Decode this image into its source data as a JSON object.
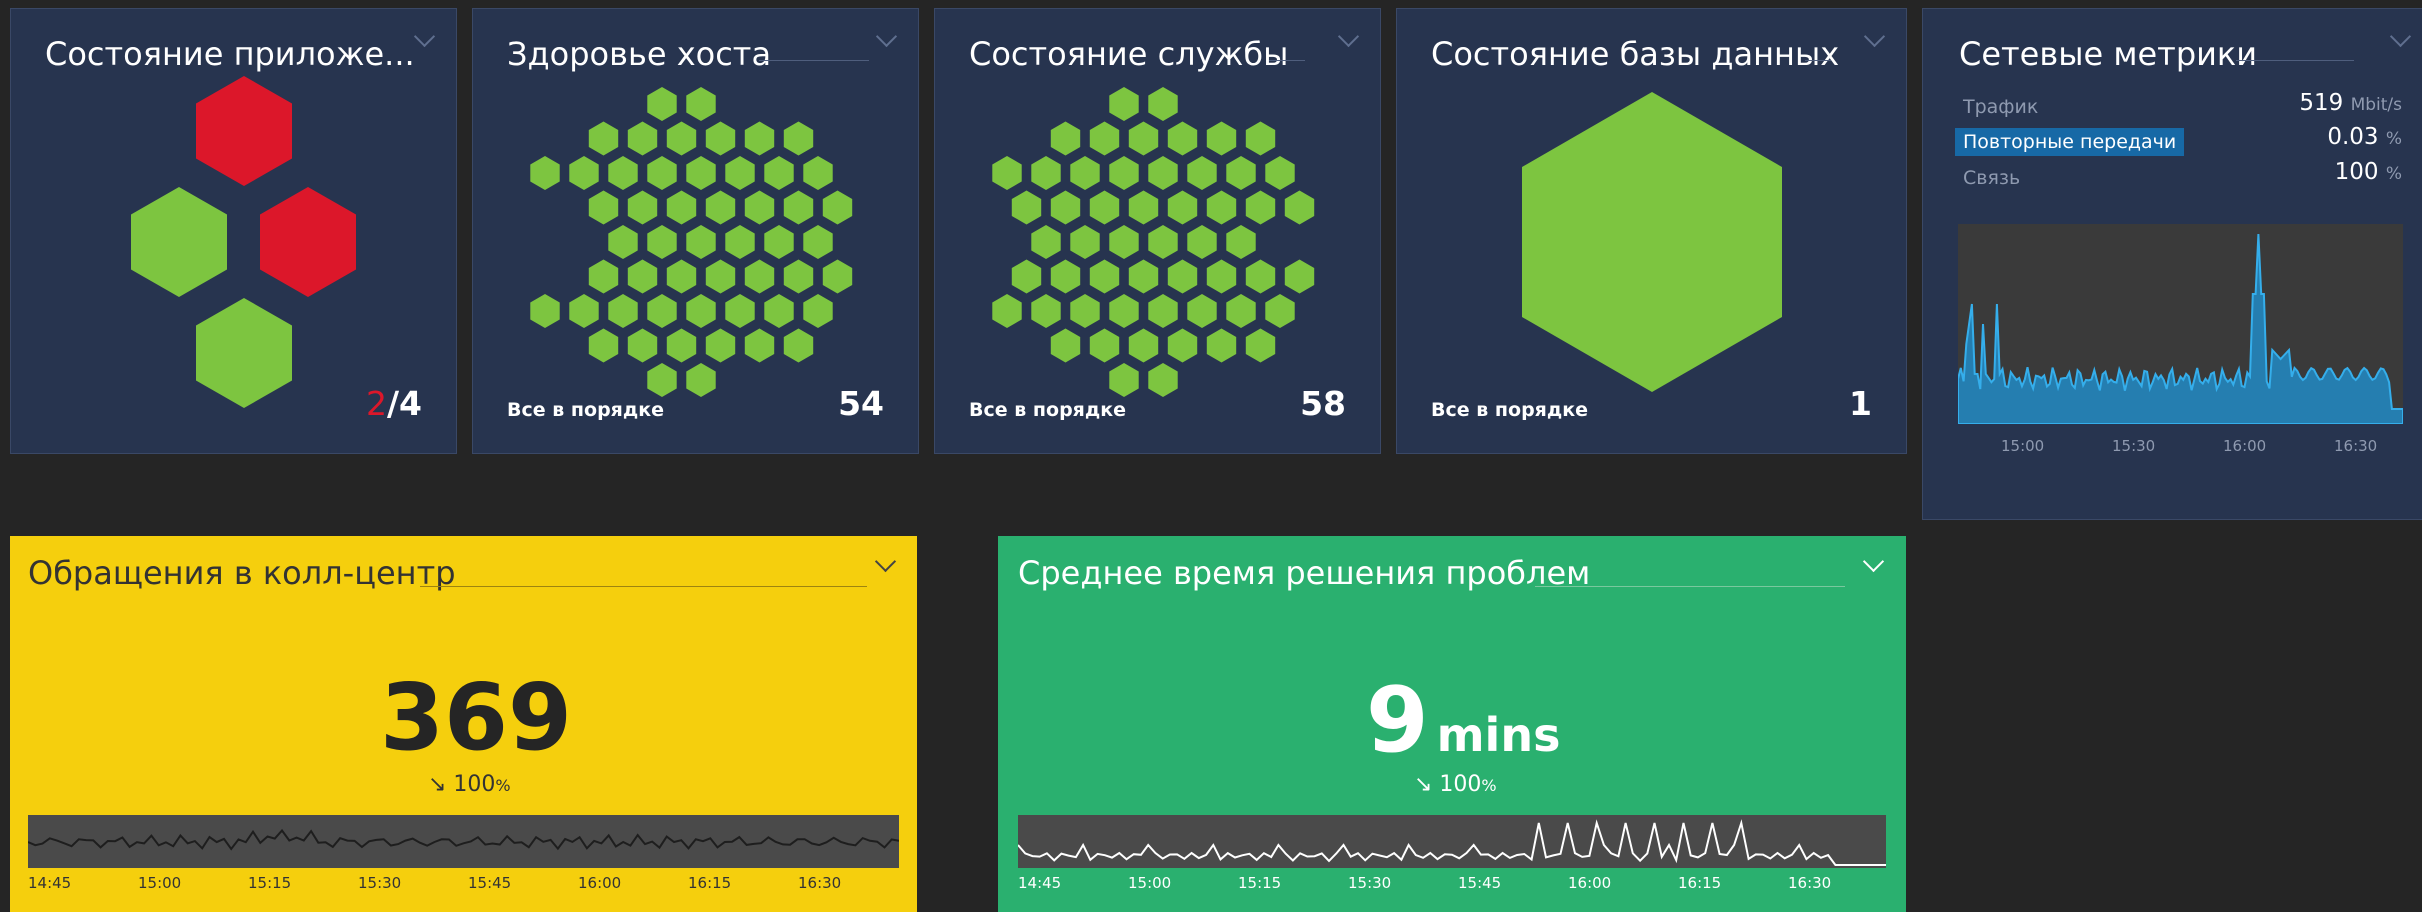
{
  "tiles": {
    "app": {
      "title": "Состояние приложе...",
      "problem_count": "2",
      "total_count": "/4"
    },
    "host": {
      "title": "Здоровье хоста",
      "status": "Все в порядке",
      "count": "54"
    },
    "service": {
      "title": "Состояние службы",
      "status": "Все в порядке",
      "count": "58"
    },
    "database": {
      "title": "Состояние базы данных",
      "status": "Все в порядке",
      "count": "1"
    }
  },
  "network": {
    "title": "Сетевые метрики",
    "metrics": [
      {
        "label": "Трафик",
        "value": "519",
        "unit": "Mbit/s"
      },
      {
        "label": "Повторные передачи",
        "value": "0.03",
        "unit": "%"
      },
      {
        "label": "Связь",
        "value": "100",
        "unit": "%"
      }
    ],
    "time_ticks": [
      "15:00",
      "15:30",
      "16:00",
      "16:30"
    ]
  },
  "calls": {
    "title": "Обращения в колл-центр",
    "value": "369",
    "change": "↘ 100",
    "change_unit": "%",
    "time_ticks": [
      "14:45",
      "15:00",
      "15:15",
      "15:30",
      "15:45",
      "16:00",
      "16:15",
      "16:30"
    ]
  },
  "resolution": {
    "title": "Среднее время решения проблем",
    "value": "9",
    "unit": "mins",
    "change": "↘ 100",
    "change_unit": "%",
    "time_ticks": [
      "14:45",
      "15:00",
      "15:15",
      "15:30",
      "15:45",
      "16:00",
      "16:15",
      "16:30"
    ]
  },
  "colors": {
    "ok": "#7dc540",
    "problem": "#dc172a",
    "tile_bg": "#27344f",
    "yellow": "#f5cf0d",
    "green": "#2ab06f",
    "chart_blue": "#1f96d8"
  }
}
